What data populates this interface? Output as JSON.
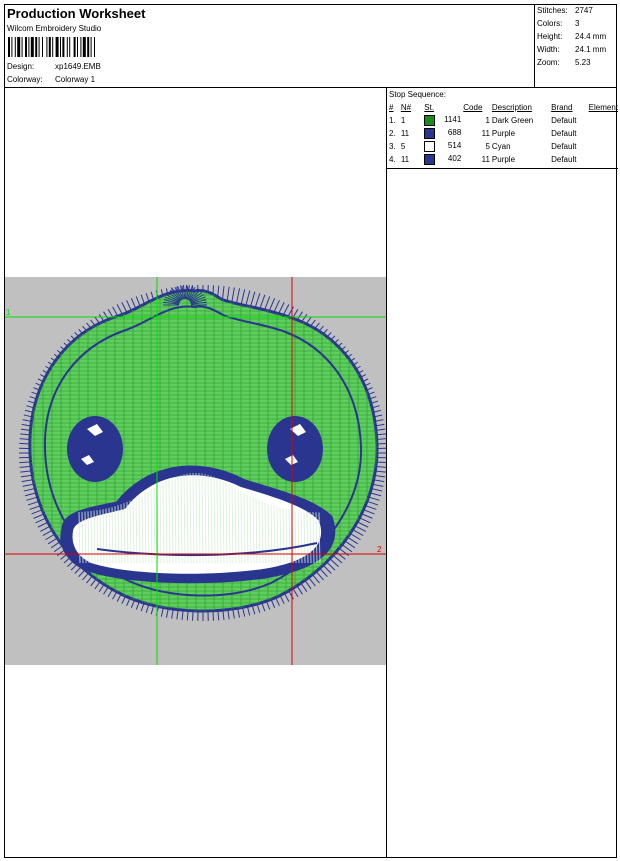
{
  "header": {
    "title": "Production Worksheet",
    "software": "Wilcom Embroidery Studio",
    "design_label": "Design:",
    "design_value": "xp1649.EMB",
    "colorway_label": "Colorway:",
    "colorway_value": "Colorway 1"
  },
  "stats": [
    {
      "label": "Stitches:",
      "value": "2747"
    },
    {
      "label": "Colors:",
      "value": "3"
    },
    {
      "label": "Height:",
      "value": "24.4 mm"
    },
    {
      "label": "Width:",
      "value": "24.1 mm"
    },
    {
      "label": "Zoom:",
      "value": "5.23"
    }
  ],
  "stop_sequence": {
    "title": "Stop Sequence:",
    "headers": {
      "num": "#",
      "needle": "N#",
      "st": "St.",
      "code": "Code",
      "description": "Description",
      "brand": "Brand",
      "element": "Element"
    },
    "rows": [
      {
        "num": "1.",
        "needle": "1",
        "color": "#1a8c1a",
        "st": "1141",
        "code": "1",
        "description": "Dark Green",
        "brand": "Default",
        "element": ""
      },
      {
        "num": "2.",
        "needle": "11",
        "color": "#2a3590",
        "st": "688",
        "code": "11",
        "description": "Purple",
        "brand": "Default",
        "element": ""
      },
      {
        "num": "3.",
        "needle": "5",
        "color": "#ffffff",
        "st": "514",
        "code": "5",
        "description": "Cyan",
        "brand": "Default",
        "element": ""
      },
      {
        "num": "4.",
        "needle": "11",
        "color": "#2a3590",
        "st": "402",
        "code": "11",
        "description": "Purple",
        "brand": "Default",
        "element": ""
      }
    ]
  },
  "design_preview": {
    "background": "#c0c0c0",
    "fill_color": "#5ccf5c",
    "outline_color": "#2a3590",
    "highlight_color": "#ffffff",
    "guide_green": "#00dd00",
    "guide_red": "#dd0000",
    "marker_1": "1",
    "marker_2": "2"
  }
}
